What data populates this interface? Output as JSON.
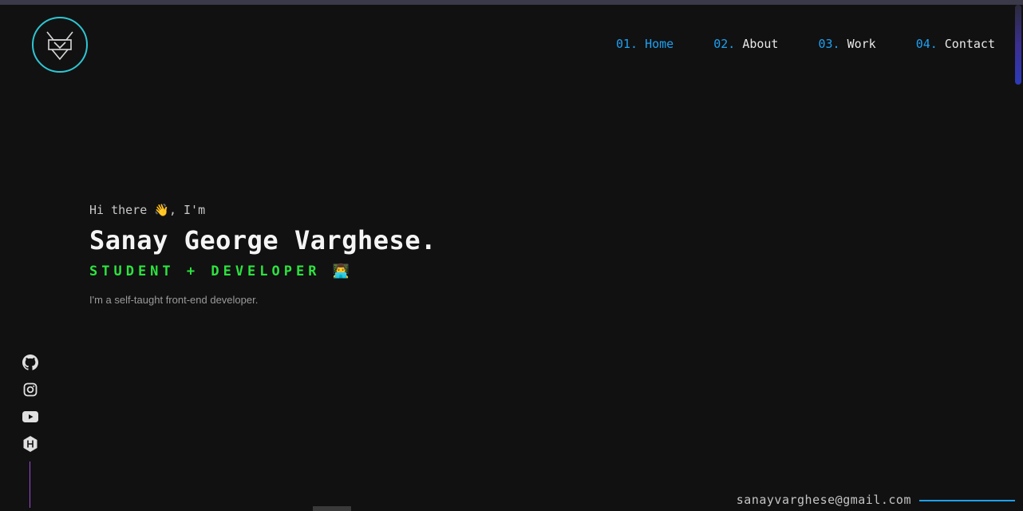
{
  "nav": {
    "items": [
      {
        "num": "01.",
        "label": "Home"
      },
      {
        "num": "02.",
        "label": "About"
      },
      {
        "num": "03.",
        "label": "Work"
      },
      {
        "num": "04.",
        "label": "Contact"
      }
    ]
  },
  "hero": {
    "greeting": "Hi there 👋, I'm",
    "name": "Sanay George Varghese.",
    "role": "STUDENT + DEVELOPER 👨‍💻",
    "tagline": "I'm a self-taught front-end developer."
  },
  "socials": [
    "github-icon",
    "instagram-icon",
    "youtube-icon",
    "hackerrank-icon"
  ],
  "contact": {
    "email": "sanayvarghese@gmail.com"
  },
  "colors": {
    "accent": "#1da1f2",
    "logo_ring": "#2ec6d3",
    "role": "#2de33f",
    "social_line": "#a14bd8",
    "background": "#111111"
  }
}
